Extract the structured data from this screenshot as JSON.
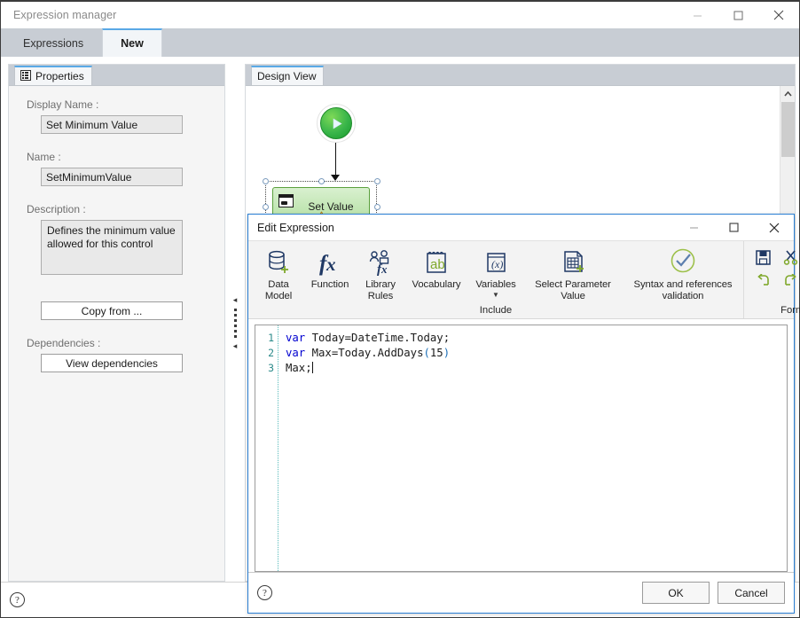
{
  "main_window": {
    "title": "Expression manager",
    "controls": {
      "minimize": "minimize-icon",
      "maximize": "maximize-icon",
      "close": "close-icon"
    },
    "tabs": [
      {
        "label": "Expressions",
        "active": false
      },
      {
        "label": "New",
        "active": true
      }
    ]
  },
  "properties_panel": {
    "tab_label": "Properties",
    "tab_icon": "properties-grid-icon",
    "fields": {
      "display_name_label": "Display Name :",
      "display_name_value": "Set Minimum Value",
      "name_label": "Name :",
      "name_value": "SetMinimumValue",
      "description_label": "Description :",
      "description_value": "Defines the minimum value allowed for this control"
    },
    "copy_from_button": "Copy from ...",
    "dependencies_label": "Dependencies :",
    "view_dependencies_button": "View dependencies"
  },
  "design_view": {
    "tab_label": "Design View",
    "start_node_icon": "play-start-icon",
    "node": {
      "label": "Set Value",
      "icon": "set-value-icon",
      "badge_icon": "warning-triangle-icon",
      "selected": true
    }
  },
  "dialog": {
    "title": "Edit Expression",
    "controls": {
      "minimize": "minimize-icon",
      "maximize": "maximize-icon",
      "close": "close-icon"
    },
    "ribbon": {
      "include_group_label": "Include",
      "format_group_label": "Format",
      "include_items": [
        {
          "label": "Data\nModel",
          "icon": "data-model-icon",
          "has_caret": false
        },
        {
          "label": "Function",
          "icon": "function-fx-icon",
          "has_caret": false
        },
        {
          "label": "Library\nRules",
          "icon": "library-rules-icon",
          "has_caret": false
        },
        {
          "label": "Vocabulary",
          "icon": "vocabulary-ab-icon",
          "has_caret": false
        },
        {
          "label": "Variables",
          "icon": "variables-x-icon",
          "has_caret": true
        },
        {
          "label": "Select Parameter\nValue",
          "icon": "select-parameter-icon",
          "has_caret": false
        },
        {
          "label": "Syntax and references\nvalidation",
          "icon": "validation-check-icon",
          "has_caret": false
        }
      ],
      "format_items": [
        {
          "icon": "save-icon"
        },
        {
          "icon": "cut-scissors-icon"
        },
        {
          "icon": "copy-icon"
        },
        {
          "icon": "paste-icon"
        },
        {
          "icon": "undo-icon"
        },
        {
          "icon": "redo-icon"
        },
        {
          "icon": "outdent-icon"
        },
        {
          "icon": "indent-icon"
        }
      ]
    },
    "editor": {
      "line_numbers": [
        "1",
        "2",
        "3"
      ],
      "lines": [
        "var Today=DateTime.Today;",
        "var Max=Today.AddDays(15)",
        "Max;"
      ]
    },
    "footer": {
      "help_icon": "help-circle-icon",
      "ok_button": "OK",
      "cancel_button": "Cancel"
    }
  },
  "main_status": {
    "help_icon": "help-circle-icon"
  },
  "colors": {
    "accent_blue": "#2a7fd4",
    "tab_active_top": "#5aa9e6",
    "tabstrip_bg": "#c8cdd4",
    "ribbon_bg": "#f3f3f3",
    "icon_navy": "#1f3864",
    "icon_green": "#7fa82b",
    "node_green": "#b4e0a4",
    "node_border_green": "#5aa03c",
    "keyword_blue": "#0000d0",
    "gutter_teal": "#2b8a8a"
  }
}
